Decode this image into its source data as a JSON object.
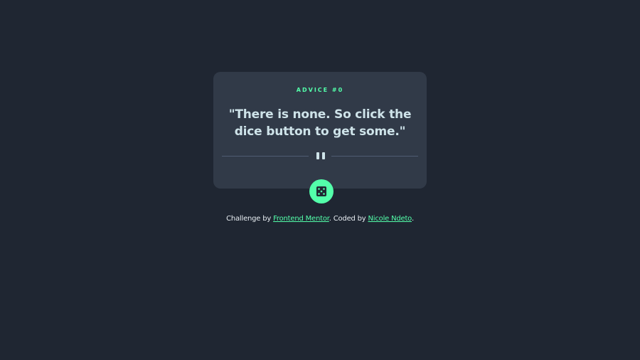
{
  "card": {
    "label": "ADVICE #0",
    "quote": "\"There is none. So click the dice button to get some.\""
  },
  "icons": {
    "divider": "pause-icon",
    "button": "dice-icon"
  },
  "colors": {
    "background": "#1f2632",
    "card": "#313a48",
    "accent": "#53ffaa",
    "quote": "#cee3e9"
  },
  "attribution": {
    "prefix": "Challenge by ",
    "link1": "Frontend Mentor",
    "middle": ". Coded by ",
    "link2": "Nicole Ndeto",
    "suffix": "."
  }
}
